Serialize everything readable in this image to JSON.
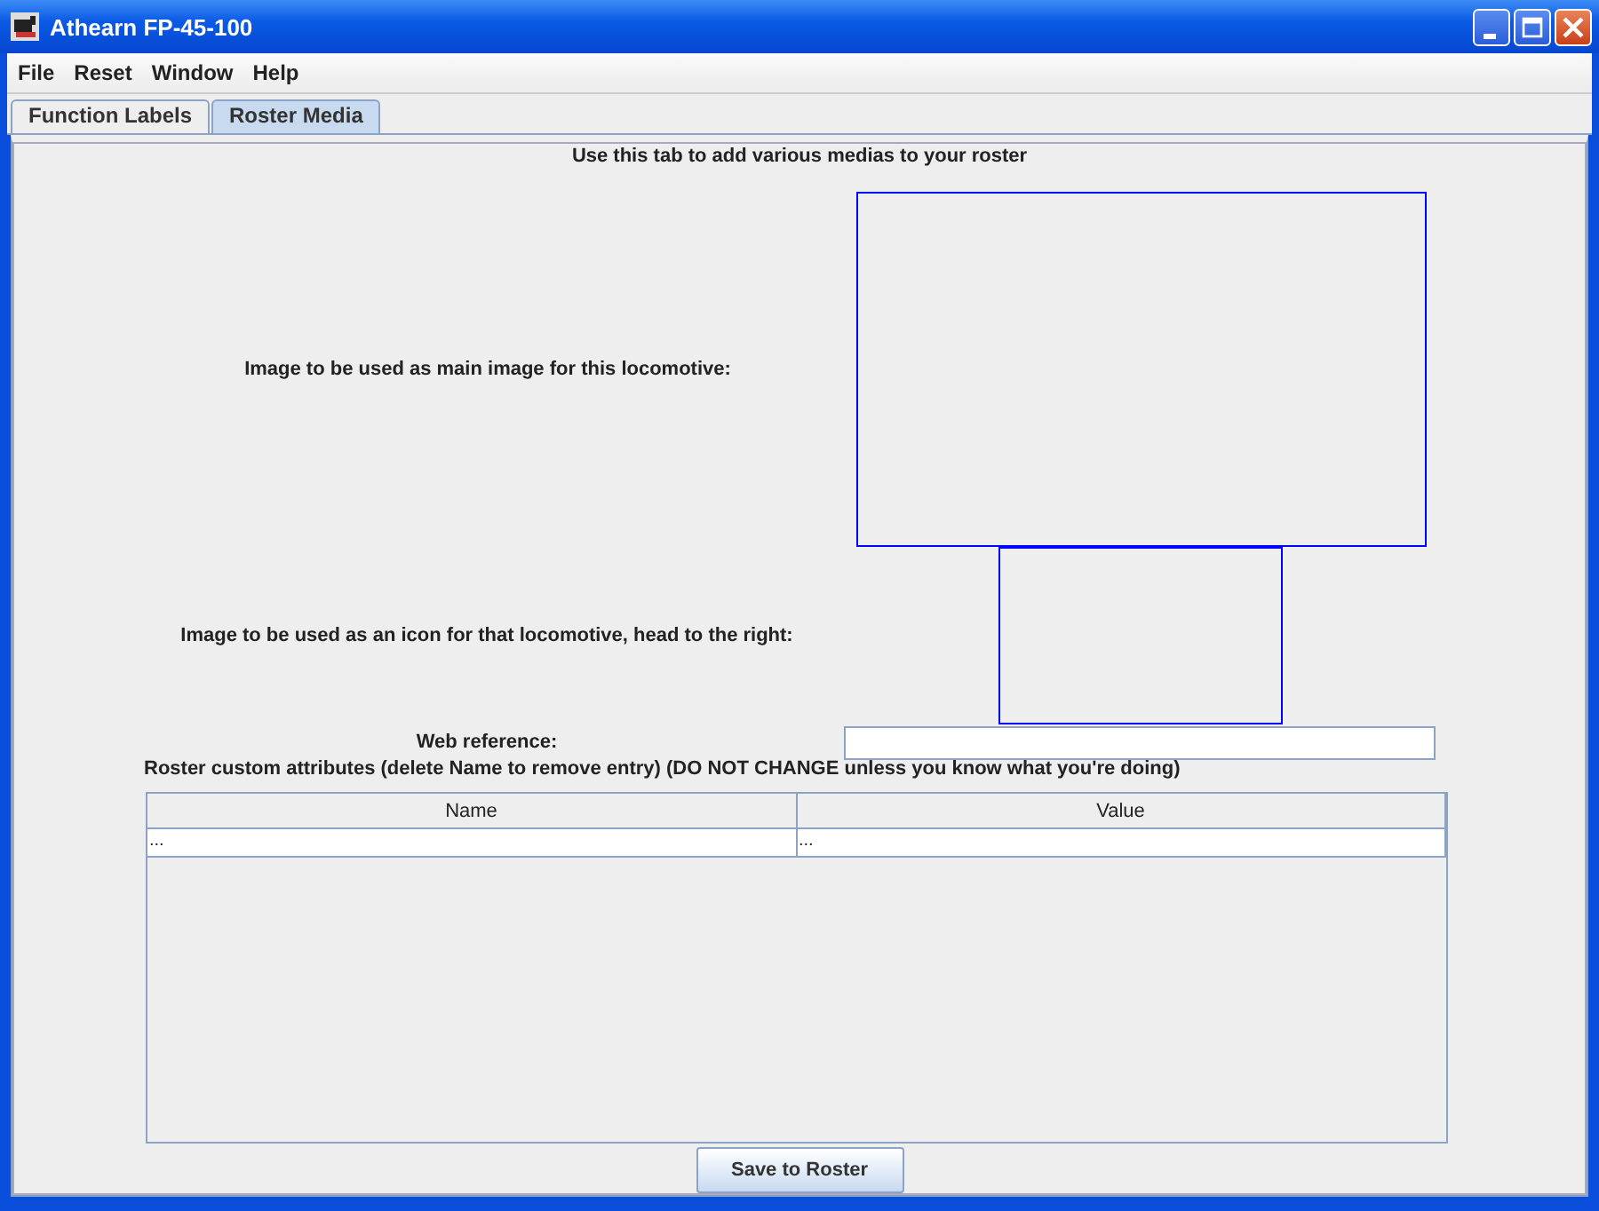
{
  "window": {
    "title": "Athearn FP-45-100"
  },
  "menu": [
    "File",
    "Reset",
    "Window",
    "Help"
  ],
  "tabs": [
    {
      "label": "Function Labels",
      "selected": false
    },
    {
      "label": "Roster Media",
      "selected": true
    }
  ],
  "media": {
    "heading": "Use this tab to add various medias to your roster",
    "main_image_label": "Image to be used as main image for this locomotive:",
    "icon_image_label": "Image to be used as an icon for that locomotive, head to the right:",
    "web_reference_label": "Web reference:",
    "attributes_label": "Roster custom attributes (delete Name to remove entry) (DO NOT CHANGE unless you know what you're doing)",
    "table": {
      "columns": [
        "Name",
        "Value"
      ],
      "rows": [
        [
          "...",
          "..."
        ]
      ]
    },
    "save_button": "Save to Roster"
  }
}
